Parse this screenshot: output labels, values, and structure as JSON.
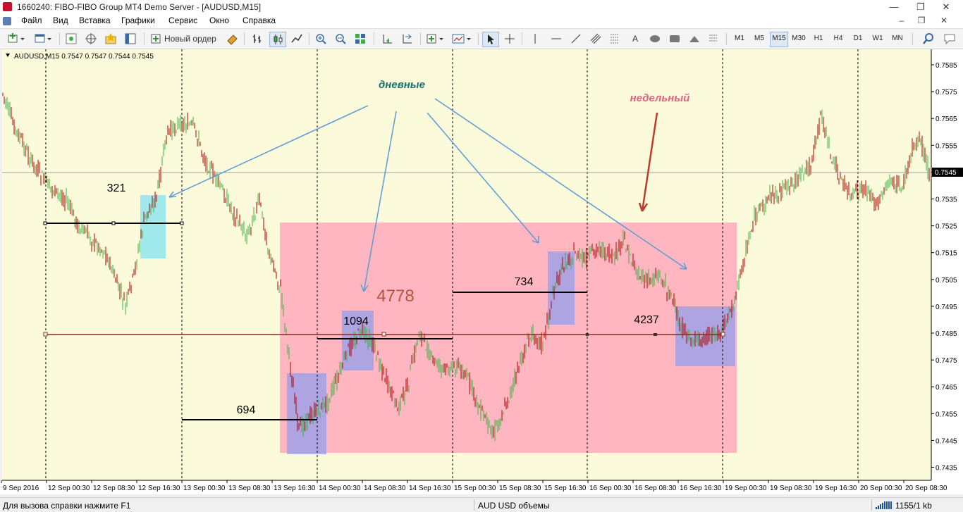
{
  "window": {
    "title": "1660240: FIBO-FIBO Group MT4 Demo Server - [AUDUSD,M15]",
    "min_glyph": "—",
    "restore_glyph": "❐",
    "close_glyph": "✕"
  },
  "menu": {
    "items": [
      "Файл",
      "Вид",
      "Вставка",
      "Графики",
      "Сервис",
      "Окно",
      "Справка"
    ],
    "mdi_min": "–",
    "mdi_restore": "❐",
    "mdi_close": "✕"
  },
  "toolbar": {
    "new_order_label": "Новый ордер",
    "text_tool": "A",
    "timeframes": [
      "M1",
      "M5",
      "M15",
      "M30",
      "H1",
      "H4",
      "D1",
      "W1",
      "MN"
    ],
    "active_timeframe": "M15"
  },
  "chart": {
    "info": "AUDUSD,M15  0.7547 0.7547 0.7544 0.7545",
    "background": "#fbfbdc",
    "y_ticks": [
      "0.7585",
      "0.7575",
      "0.7565",
      "0.7555",
      "0.7545",
      "0.7535",
      "0.7525",
      "0.7515",
      "0.7505",
      "0.7495",
      "0.7485",
      "0.7475",
      "0.7465",
      "0.7455",
      "0.7445",
      "0.7435"
    ],
    "current_price": "0.7545",
    "x_labels": [
      "9 Sep 2016",
      "12 Sep 00:30",
      "12 Sep 08:30",
      "12 Sep 16:30",
      "13 Sep 00:30",
      "13 Sep 08:30",
      "13 Sep 16:30",
      "14 Sep 00:30",
      "14 Sep 08:30",
      "14 Sep 16:30",
      "15 Sep 00:30",
      "15 Sep 08:30",
      "15 Sep 16:30",
      "16 Sep 00:30",
      "16 Sep 08:30",
      "16 Sep 16:30",
      "19 Sep 00:30",
      "19 Sep 08:30",
      "19 Sep 16:30",
      "20 Sep 00:30",
      "20 Sep 08:30"
    ],
    "annotations": {
      "daily_label": "дневные",
      "weekly_label": "недельный",
      "v321": "321",
      "v694": "694",
      "v1094": "1094",
      "v734": "734",
      "v4778": "4778",
      "v4237": "4237"
    },
    "colors": {
      "weekly_zone": "#ffb6c1",
      "daily_zone": "#8c9cf0",
      "zone_321": "#8ee4ee",
      "arrow_blue": "#5b9bd5",
      "arrow_red": "#c0392b",
      "label_daily": "#1f6f6f",
      "label_weekly": "#e06080",
      "label_4778": "#b5533c",
      "bull_candle": "#3cb043",
      "bear_candle": "#b00000",
      "price_line": "#8c2a1a"
    }
  },
  "status": {
    "help": "Для вызова справки нажмите F1",
    "profile": "AUD USD объемы",
    "traffic": "1155/1 kb"
  }
}
